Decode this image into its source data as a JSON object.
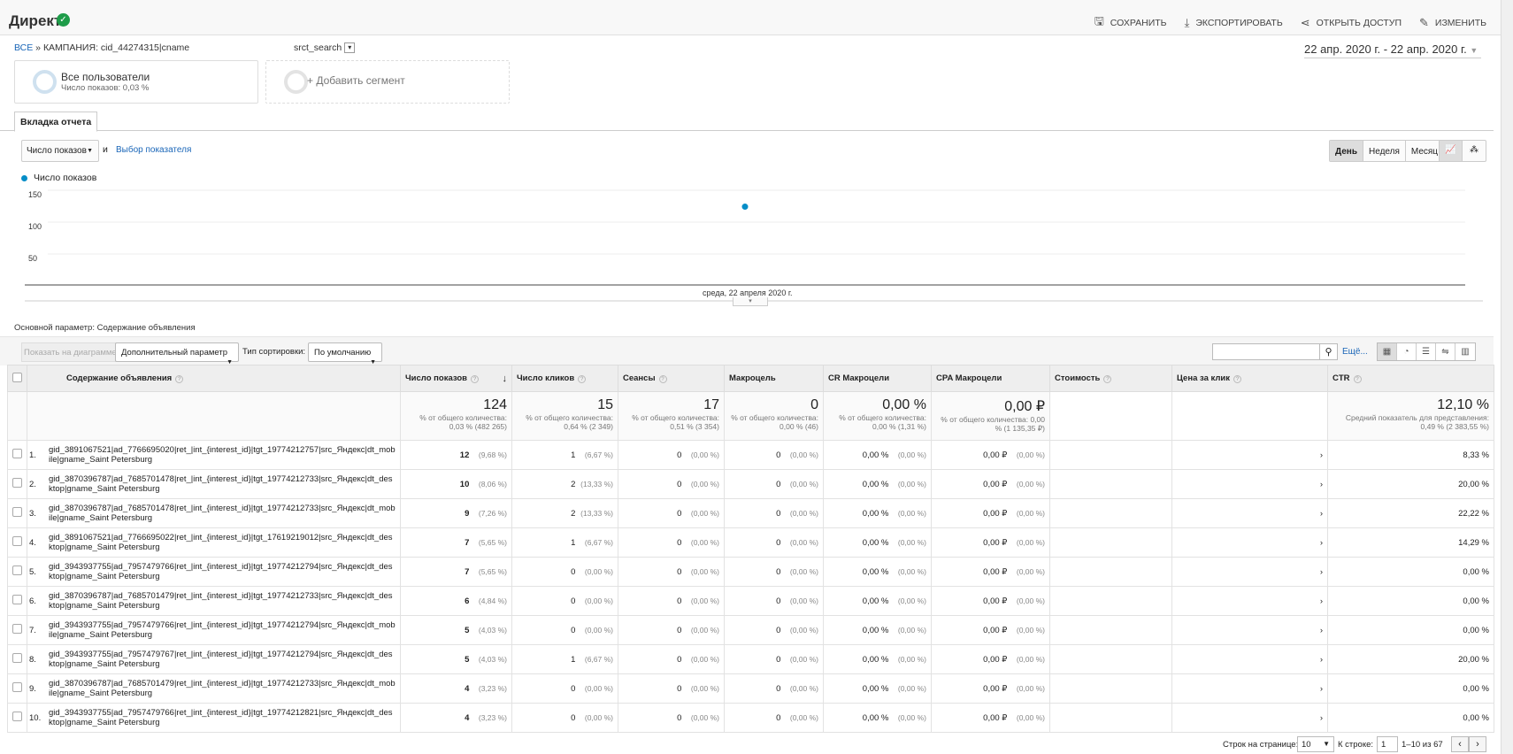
{
  "header": {
    "title": "Директ",
    "save": "СОХРАНИТЬ",
    "export": "ЭКСПОРТИРОВАТЬ",
    "share": "ОТКРЫТЬ ДОСТУП",
    "edit": "ИЗМЕНИТЬ"
  },
  "breadcrumb": {
    "all": "ВСЕ",
    "sep": "»",
    "campaign": "КАМПАНИЯ: cid_44274315|cname"
  },
  "source": "srct_search",
  "date_range": "22 апр. 2020 г. - 22 апр. 2020 г.",
  "segments": {
    "seg1_label": "Все пользователи",
    "seg1_sub": "Число показов: 0,03 %",
    "add": "+ Добавить сегмент"
  },
  "report_tab": "Вкладка отчета",
  "metric_select": "Число показов",
  "and_label": "и",
  "pick_metric": "Выбор показателя",
  "period": {
    "day": "День",
    "week": "Неделя",
    "month": "Месяц"
  },
  "legend": "Число показов",
  "chart_data": {
    "type": "scatter",
    "series": [
      {
        "name": "Число показов",
        "values": [
          124
        ]
      }
    ],
    "categories": [
      "среда, 22 апреля 2020 г."
    ],
    "yticks": [
      "150",
      "100",
      "50"
    ],
    "ylim": [
      0,
      150
    ],
    "point_color": "#058dc7"
  },
  "primary_dim": "Основной параметр:  Содержание объявления",
  "toolbar": {
    "show_chart": "Показать на диаграмме",
    "secondary": "Дополнительный параметр",
    "sort_label": "Тип сортировки:",
    "sort_value": "По умолчанию",
    "more": "Ещё..."
  },
  "columns": [
    "Содержание объявления",
    "Число показов",
    "Число кликов",
    "Сеансы",
    "Макроцель",
    "CR Макроцели",
    "CPA Макроцели",
    "Стоимость",
    "Цена за клик",
    "CTR"
  ],
  "totals": [
    {
      "big": "124",
      "small": "% от общего количества: 0,03 % (482 265)"
    },
    {
      "big": "15",
      "small": "% от общего количества: 0,64 % (2 349)"
    },
    {
      "big": "17",
      "small": "% от общего количества: 0,51 % (3 354)"
    },
    {
      "big": "0",
      "small": "% от общего количества: 0,00 % (46)"
    },
    {
      "big": "0,00 %",
      "small": "% от общего количества: 0,00 % (1,31 %)"
    },
    {
      "big": "0,00 ₽",
      "small": "% от общего количества: 0,00 % (1 135,35 ₽)"
    },
    {
      "big": "12,10 %",
      "small": "Средний показатель для представления: 0,49 % (2 383,55 %)"
    }
  ],
  "rows": [
    {
      "n": "1.",
      "ad": "gid_3891067521|ad_7766695020|ret_|int_{interest_id}|tgt_19774212757|src_Яндекс|dt_mobile|gname_Saint Petersburg",
      "imp": "12",
      "impp": "(9,68 %)",
      "clk": "1",
      "clkp": "(6,67 %)",
      "ses": "0",
      "sesp": "(0,00 %)",
      "mac": "0",
      "macp": "(0,00 %)",
      "cr": "0,00 %",
      "crp": "(0,00 %)",
      "cpa": "0,00 ₽",
      "cpap": "(0,00 %)",
      "ctr": "8,33 %"
    },
    {
      "n": "2.",
      "ad": "gid_3870396787|ad_7685701478|ret_|int_{interest_id}|tgt_19774212733|src_Яндекс|dt_desktop|gname_Saint Petersburg",
      "imp": "10",
      "impp": "(8,06 %)",
      "clk": "2",
      "clkp": "(13,33 %)",
      "ses": "0",
      "sesp": "(0,00 %)",
      "mac": "0",
      "macp": "(0,00 %)",
      "cr": "0,00 %",
      "crp": "(0,00 %)",
      "cpa": "0,00 ₽",
      "cpap": "(0,00 %)",
      "ctr": "20,00 %"
    },
    {
      "n": "3.",
      "ad": "gid_3870396787|ad_7685701478|ret_|int_{interest_id}|tgt_19774212733|src_Яндекс|dt_mobile|gname_Saint Petersburg",
      "imp": "9",
      "impp": "(7,26 %)",
      "clk": "2",
      "clkp": "(13,33 %)",
      "ses": "0",
      "sesp": "(0,00 %)",
      "mac": "0",
      "macp": "(0,00 %)",
      "cr": "0,00 %",
      "crp": "(0,00 %)",
      "cpa": "0,00 ₽",
      "cpap": "(0,00 %)",
      "ctr": "22,22 %"
    },
    {
      "n": "4.",
      "ad": "gid_3891067521|ad_7766695022|ret_|int_{interest_id}|tgt_17619219012|src_Яндекс|dt_desktop|gname_Saint Petersburg",
      "imp": "7",
      "impp": "(5,65 %)",
      "clk": "1",
      "clkp": "(6,67 %)",
      "ses": "0",
      "sesp": "(0,00 %)",
      "mac": "0",
      "macp": "(0,00 %)",
      "cr": "0,00 %",
      "crp": "(0,00 %)",
      "cpa": "0,00 ₽",
      "cpap": "(0,00 %)",
      "ctr": "14,29 %"
    },
    {
      "n": "5.",
      "ad": "gid_3943937755|ad_7957479766|ret_|int_{interest_id}|tgt_19774212794|src_Яндекс|dt_desktop|gname_Saint Petersburg",
      "imp": "7",
      "impp": "(5,65 %)",
      "clk": "0",
      "clkp": "(0,00 %)",
      "ses": "0",
      "sesp": "(0,00 %)",
      "mac": "0",
      "macp": "(0,00 %)",
      "cr": "0,00 %",
      "crp": "(0,00 %)",
      "cpa": "0,00 ₽",
      "cpap": "(0,00 %)",
      "ctr": "0,00 %"
    },
    {
      "n": "6.",
      "ad": "gid_3870396787|ad_7685701479|ret_|int_{interest_id}|tgt_19774212733|src_Яндекс|dt_desktop|gname_Saint Petersburg",
      "imp": "6",
      "impp": "(4,84 %)",
      "clk": "0",
      "clkp": "(0,00 %)",
      "ses": "0",
      "sesp": "(0,00 %)",
      "mac": "0",
      "macp": "(0,00 %)",
      "cr": "0,00 %",
      "crp": "(0,00 %)",
      "cpa": "0,00 ₽",
      "cpap": "(0,00 %)",
      "ctr": "0,00 %"
    },
    {
      "n": "7.",
      "ad": "gid_3943937755|ad_7957479766|ret_|int_{interest_id}|tgt_19774212794|src_Яндекс|dt_mobile|gname_Saint Petersburg",
      "imp": "5",
      "impp": "(4,03 %)",
      "clk": "0",
      "clkp": "(0,00 %)",
      "ses": "0",
      "sesp": "(0,00 %)",
      "mac": "0",
      "macp": "(0,00 %)",
      "cr": "0,00 %",
      "crp": "(0,00 %)",
      "cpa": "0,00 ₽",
      "cpap": "(0,00 %)",
      "ctr": "0,00 %"
    },
    {
      "n": "8.",
      "ad": "gid_3943937755|ad_7957479767|ret_|int_{interest_id}|tgt_19774212794|src_Яндекс|dt_desktop|gname_Saint Petersburg",
      "imp": "5",
      "impp": "(4,03 %)",
      "clk": "1",
      "clkp": "(6,67 %)",
      "ses": "0",
      "sesp": "(0,00 %)",
      "mac": "0",
      "macp": "(0,00 %)",
      "cr": "0,00 %",
      "crp": "(0,00 %)",
      "cpa": "0,00 ₽",
      "cpap": "(0,00 %)",
      "ctr": "20,00 %"
    },
    {
      "n": "9.",
      "ad": "gid_3870396787|ad_7685701479|ret_|int_{interest_id}|tgt_19774212733|src_Яндекс|dt_mobile|gname_Saint Petersburg",
      "imp": "4",
      "impp": "(3,23 %)",
      "clk": "0",
      "clkp": "(0,00 %)",
      "ses": "0",
      "sesp": "(0,00 %)",
      "mac": "0",
      "macp": "(0,00 %)",
      "cr": "0,00 %",
      "crp": "(0,00 %)",
      "cpa": "0,00 ₽",
      "cpap": "(0,00 %)",
      "ctr": "0,00 %"
    },
    {
      "n": "10.",
      "ad": "gid_3943937755|ad_7957479766|ret_|int_{interest_id}|tgt_19774212821|src_Яндекс|dt_desktop|gname_Saint Petersburg",
      "imp": "4",
      "impp": "(3,23 %)",
      "clk": "0",
      "clkp": "(0,00 %)",
      "ses": "0",
      "sesp": "(0,00 %)",
      "mac": "0",
      "macp": "(0,00 %)",
      "cr": "0,00 %",
      "crp": "(0,00 %)",
      "cpa": "0,00 ₽",
      "cpap": "(0,00 %)",
      "ctr": "0,00 %"
    }
  ],
  "footer": {
    "rows_label": "Строк на странице:",
    "rows_value": "10",
    "goto_label": "К строке:",
    "goto_value": "1",
    "count": "1–10 из 67"
  }
}
